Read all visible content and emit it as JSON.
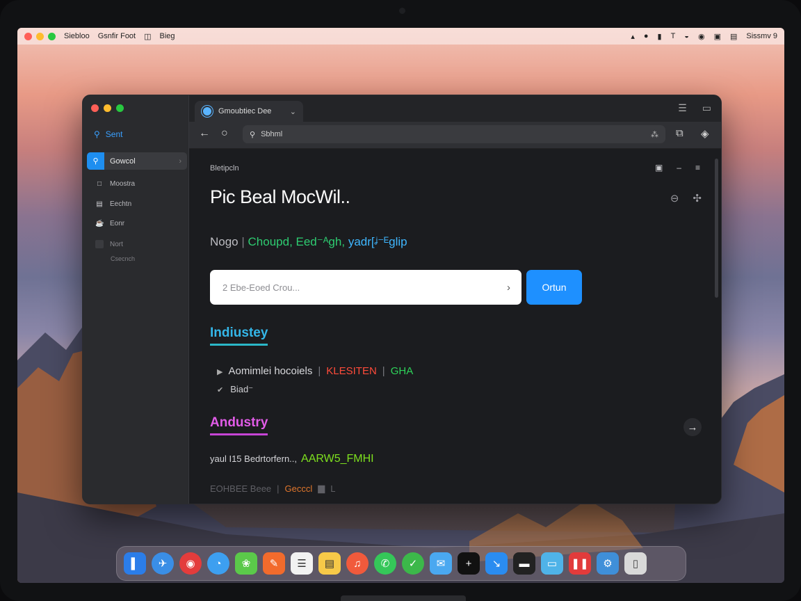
{
  "menubar": {
    "items": [
      "Siebloo",
      "Gsnfir Foot",
      "◫",
      "Bieg"
    ],
    "right_text": "Sissmv 9"
  },
  "sidebar": {
    "search_label": "Sent",
    "active_item": "Gowcol",
    "items": [
      {
        "label": "Moostra",
        "icon": "□"
      },
      {
        "label": "Eechtn",
        "icon": "▤"
      },
      {
        "label": "Eonr",
        "icon": "☕"
      },
      {
        "label": "Nort",
        "icon": ""
      }
    ],
    "sub_label": "Csecnch"
  },
  "browser": {
    "tab_title": "Gmoubtiec Dee",
    "url_text": "Sbhml"
  },
  "page": {
    "breadcrumb": "Bletipcln",
    "title": "Pic Beal MocWil..",
    "tagline": {
      "a": "Nogo",
      "b": "Choupd, Eed⁻ᴬgh,",
      "c": "yadr[ᶨ⁻ᴱglip"
    },
    "input_value": "2 Ebe-Eoed Crou...",
    "button_label": "Ortun",
    "section1": {
      "heading": "Indiustey",
      "row1": {
        "lead": "Aomimlei hocoiels",
        "red": "KLESITEN",
        "green": "GHA"
      },
      "row2": "Biad⁻"
    },
    "section2": {
      "heading": "Andustry",
      "row3": {
        "lead": "yaul I15 Bedrtorfern..,",
        "accent": "AARW5_FMHI"
      },
      "row4": {
        "lead": "EOHBEE Beee",
        "accent": "Gecccl",
        "tail": "L"
      }
    }
  },
  "colors": {
    "accent_blue": "#1e90ff",
    "heading_cyan": "#34b6e8",
    "heading_magenta": "#e25ce8",
    "text_green": "#2ecc71",
    "text_red": "#ff4b3a",
    "text_lime": "#7ee01f"
  }
}
